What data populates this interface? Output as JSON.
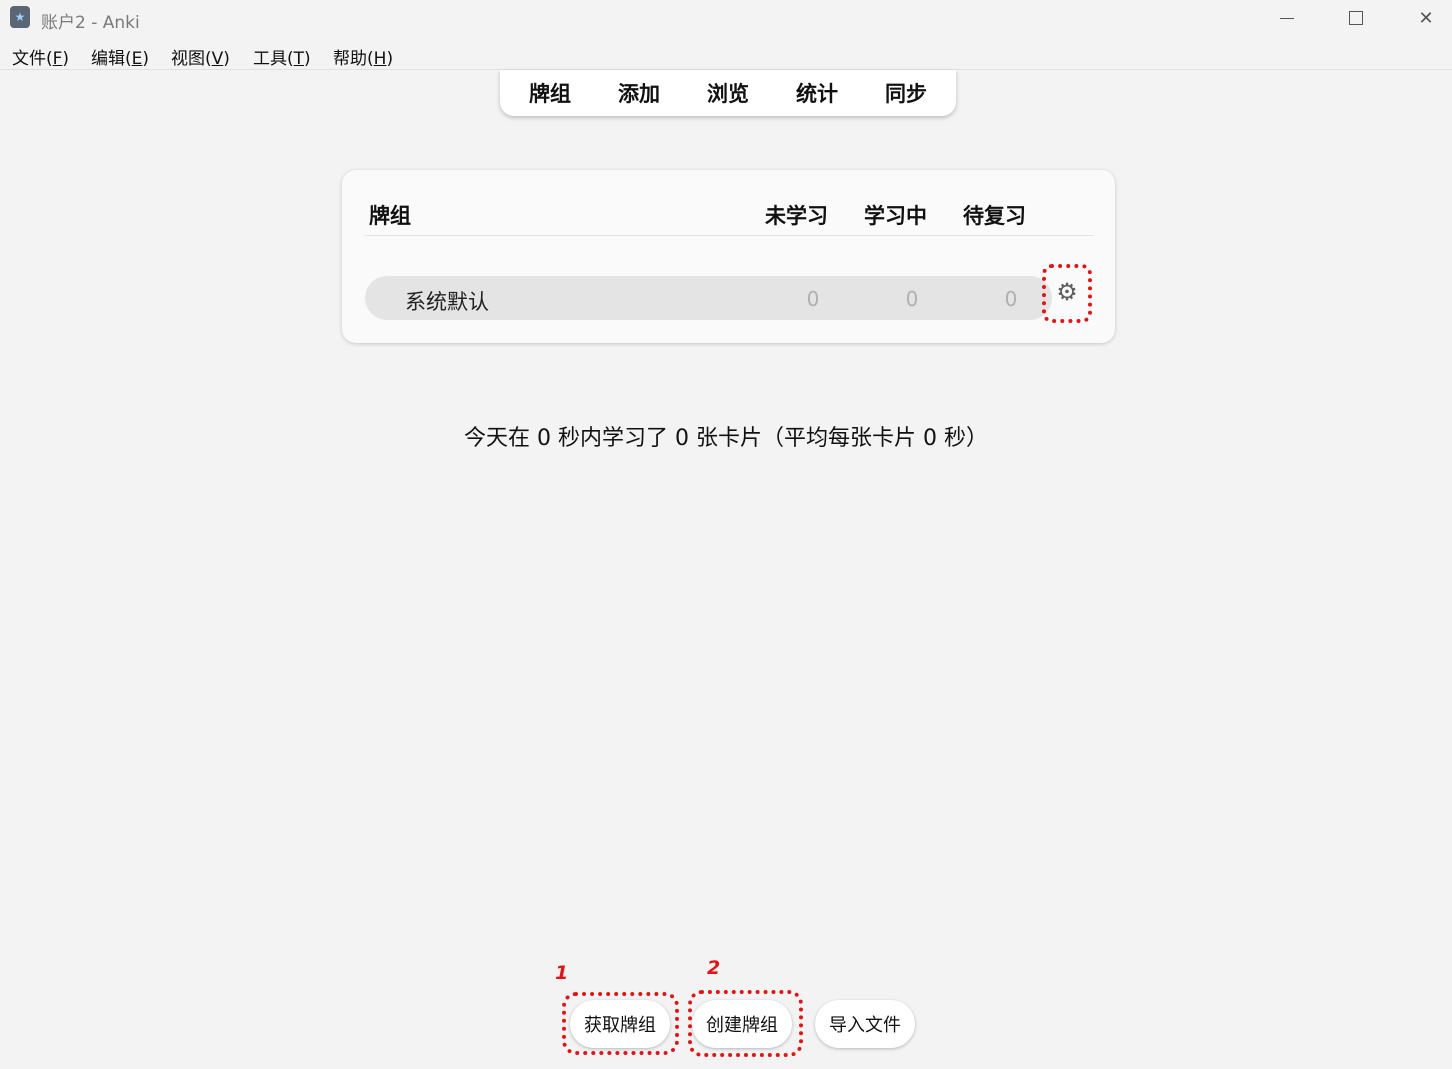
{
  "window": {
    "title": "账户2 - Anki",
    "icon": "anki-star-icon",
    "controls": [
      "minimize-icon",
      "maximize-icon",
      "close-icon"
    ]
  },
  "menu": {
    "items": [
      {
        "label": "文件(",
        "key": "F",
        "suffix": ")"
      },
      {
        "label": "编辑(",
        "key": "E",
        "suffix": ")"
      },
      {
        "label": "视图(",
        "key": "V",
        "suffix": ")"
      },
      {
        "label": "工具(",
        "key": "T",
        "suffix": ")"
      },
      {
        "label": "帮助(",
        "key": "H",
        "suffix": ")"
      }
    ]
  },
  "toolbar": {
    "items": [
      "牌组",
      "添加",
      "浏览",
      "统计",
      "同步"
    ]
  },
  "deck_table": {
    "headers": {
      "deck": "牌组",
      "new": "未学习",
      "learning": "学习中",
      "due": "待复习"
    },
    "rows": [
      {
        "name": "系统默认",
        "new": "0",
        "learning": "0",
        "due": "0",
        "options_icon": "gear-icon"
      }
    ]
  },
  "stats_text": "今天在 0 秒内学习了 0 张卡片（平均每张卡片 0 秒）",
  "bottom_buttons": {
    "get_shared": "获取牌组",
    "create_deck": "创建牌组",
    "import_file": "导入文件"
  },
  "annotations": {
    "callout_1": "1",
    "callout_2": "2",
    "highlight_color": "#e01515"
  }
}
